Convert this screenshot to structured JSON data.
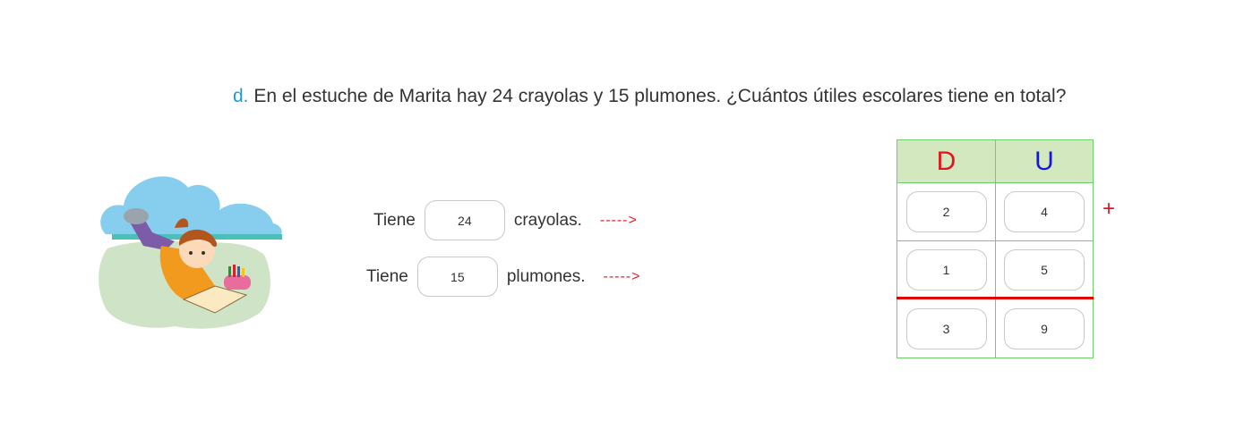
{
  "question": {
    "letter": "d.",
    "text": "En el estuche de Marita hay 24 crayolas y 15 plumones. ¿Cuántos útiles escolares tiene en total?"
  },
  "rows": [
    {
      "prefix": "Tiene",
      "value": "24",
      "suffix": "crayolas.",
      "arrow": "----->"
    },
    {
      "prefix": "Tiene",
      "value": "15",
      "suffix": "plumones.",
      "arrow": "----->"
    }
  ],
  "table": {
    "headers": [
      "D",
      "U"
    ],
    "addends": [
      [
        "2",
        "4"
      ],
      [
        "1",
        "5"
      ]
    ],
    "result": [
      "3",
      "9"
    ],
    "operator": "+"
  },
  "colors": {
    "question_letter": "#1a9cd8",
    "header_d": "#e3141a",
    "header_u": "#1515e0",
    "header_bg": "#d3e8bf",
    "grid_border": "#6ccf6c",
    "sum_line": "#e00000",
    "arrow": "#e0202c"
  }
}
